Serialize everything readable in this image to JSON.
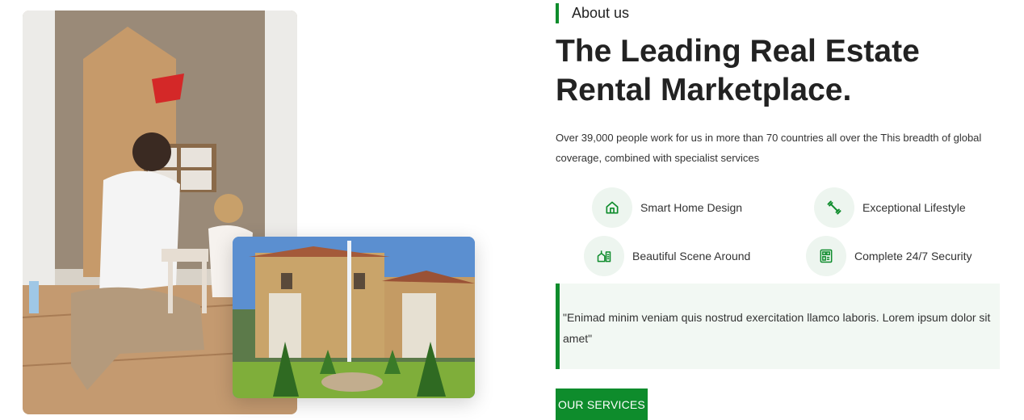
{
  "about": {
    "eyebrow": "About us",
    "title": "The Leading Real Estate Rental Marketplace.",
    "description": "Over 39,000 people work for us in more than 70 countries all over the This breadth of global coverage, combined with specialist services"
  },
  "features": [
    {
      "label": "Smart Home Design",
      "icon": "house-icon"
    },
    {
      "label": "Exceptional Lifestyle",
      "icon": "dumbbell-icon"
    },
    {
      "label": "Beautiful Scene Around",
      "icon": "scenery-icon"
    },
    {
      "label": "Complete 24/7 Security",
      "icon": "security-icon"
    }
  ],
  "quote": "\"Enimad minim veniam quis nostrud exercitation llamco laboris. Lorem ipsum dolor sit amet\"",
  "cta_label": "OUR SERVICES",
  "colors": {
    "accent": "#0e8c2c",
    "icon_bg": "#edf5ef",
    "quote_bg": "#f2f8f3",
    "text": "#222222"
  }
}
